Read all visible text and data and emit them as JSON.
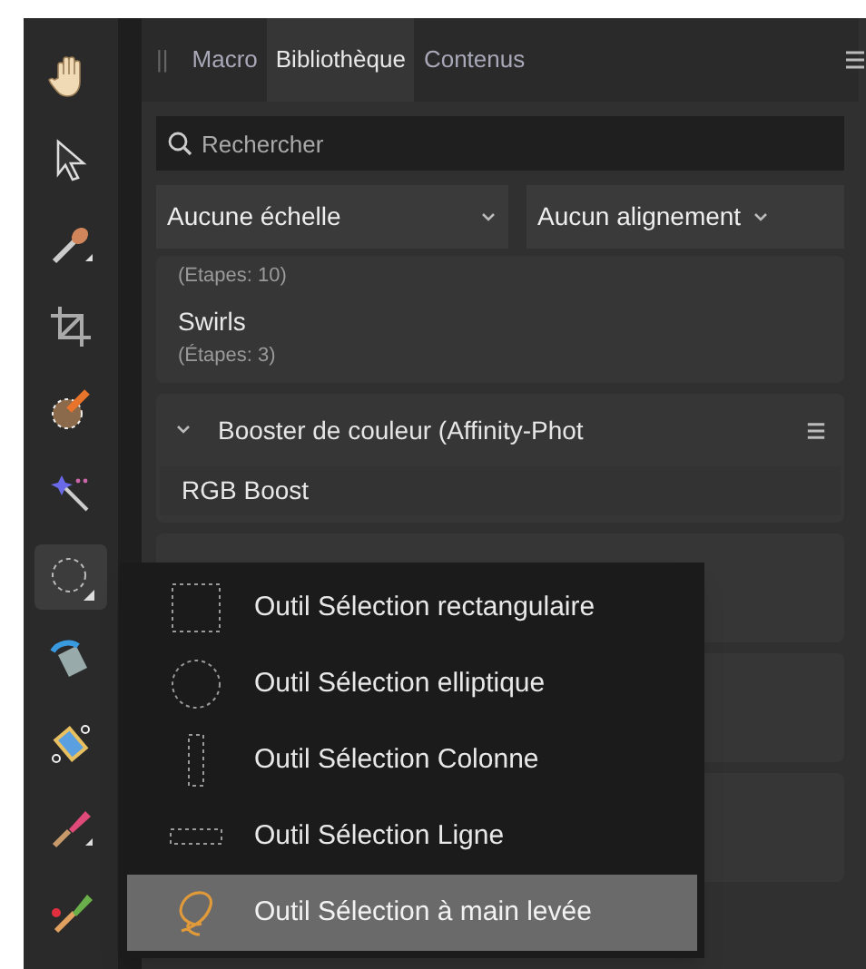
{
  "toolbar": {
    "tools": [
      {
        "kind": "hand",
        "selected": false
      },
      {
        "kind": "pointer",
        "selected": false
      },
      {
        "kind": "brush",
        "selected": false
      },
      {
        "kind": "crop",
        "selected": false
      },
      {
        "kind": "selection-brush",
        "selected": false
      },
      {
        "kind": "wand",
        "selected": false
      },
      {
        "kind": "ellipse-select",
        "selected": true
      },
      {
        "kind": "fill",
        "selected": false
      },
      {
        "kind": "gradient",
        "selected": false
      },
      {
        "kind": "paint",
        "selected": false
      },
      {
        "kind": "retouch",
        "selected": false
      }
    ]
  },
  "panel": {
    "grip": "||",
    "tabs": [
      {
        "label": "Macro",
        "selected": false
      },
      {
        "label": "Bibliothèque",
        "selected": true
      },
      {
        "label": "Contenus",
        "selected": false
      }
    ],
    "search": {
      "placeholder": "Rechercher"
    },
    "dropdowns": [
      {
        "value": "Aucune échelle"
      },
      {
        "value": "Aucun alignement"
      }
    ],
    "groups": [
      {
        "items": [
          {
            "steps": "(Etapes: 10)"
          },
          {
            "name": "Swirls",
            "steps": "(Étapes: 3)"
          }
        ]
      },
      {
        "title": "Booster de couleur (Affinity-Phot",
        "expanded": true,
        "items": [
          {
            "name": "RGB Boost"
          }
        ]
      }
    ]
  },
  "flyout": {
    "items": [
      {
        "kind": "rect",
        "label": "Outil Sélection rectangulaire",
        "selected": false
      },
      {
        "kind": "ellipse",
        "label": "Outil Sélection elliptique",
        "selected": false
      },
      {
        "kind": "column",
        "label": "Outil Sélection Colonne",
        "selected": false
      },
      {
        "kind": "row",
        "label": "Outil Sélection Ligne",
        "selected": false
      },
      {
        "kind": "freehand",
        "label": "Outil Sélection à main levée",
        "selected": true
      }
    ]
  }
}
